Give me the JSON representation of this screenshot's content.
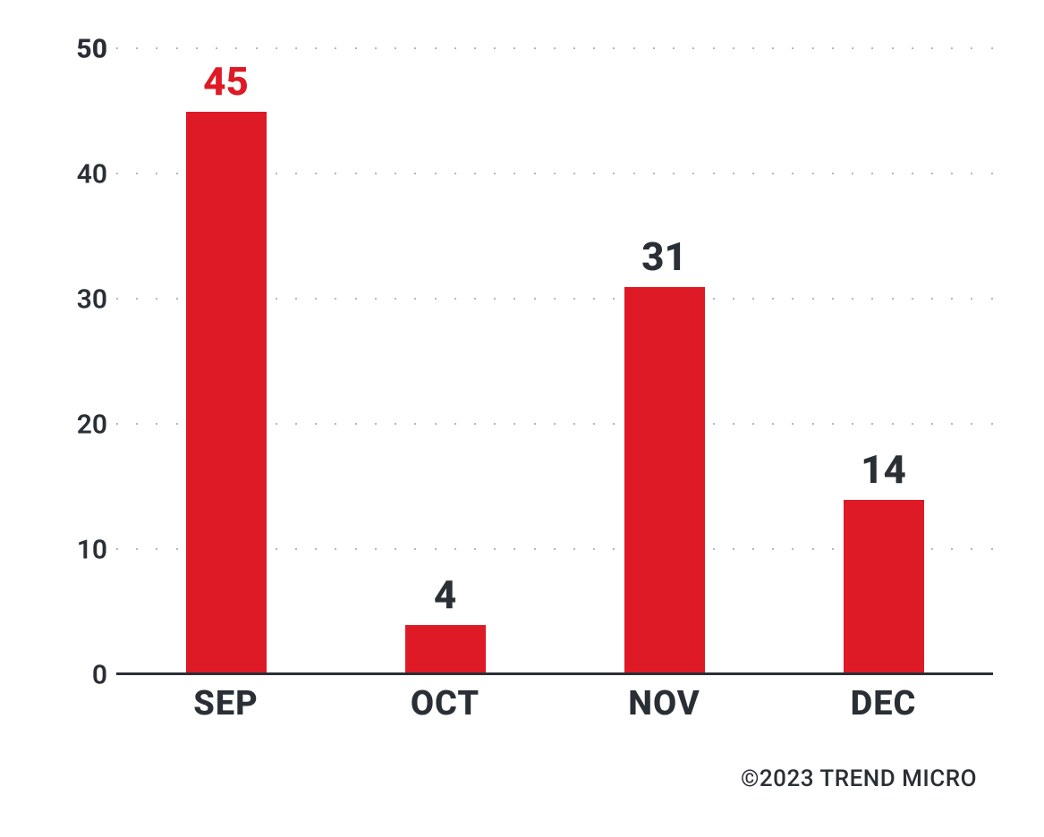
{
  "chart_data": {
    "type": "bar",
    "categories": [
      "SEP",
      "OCT",
      "NOV",
      "DEC"
    ],
    "values": [
      45,
      4,
      31,
      14
    ],
    "highlight_index": 0,
    "ylim": [
      0,
      50
    ],
    "yticks": [
      0,
      10,
      20,
      30,
      40,
      50
    ],
    "xlabel": "",
    "ylabel": "",
    "title": ""
  },
  "footer": "©2023 TREND MICRO",
  "colors": {
    "bar": "#dd1a25",
    "text": "#2a2f36",
    "highlight": "#dd1a25"
  }
}
